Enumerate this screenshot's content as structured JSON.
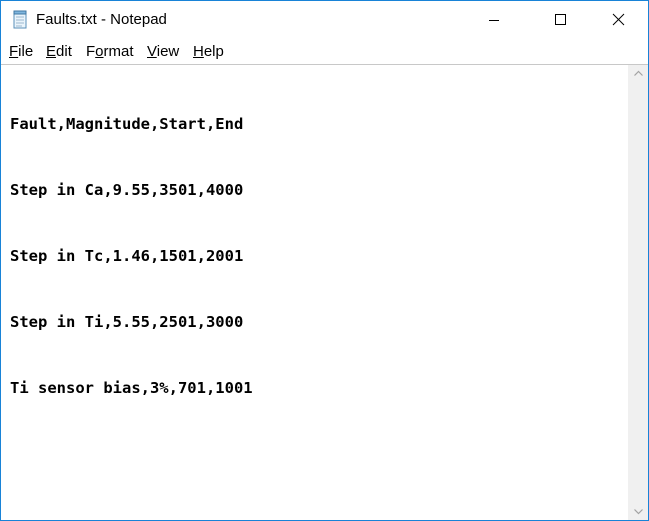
{
  "window": {
    "title": "Faults.txt - Notepad"
  },
  "title_icons": {
    "app": "notepad-icon",
    "minimize": "minimize-icon",
    "maximize": "maximize-icon",
    "close": "close-icon"
  },
  "menu": {
    "file": {
      "mnemonic": "F",
      "rest": "ile"
    },
    "edit": {
      "mnemonic": "E",
      "rest": "dit"
    },
    "format": {
      "mnemonic": "o",
      "pre": "F",
      "rest": "rmat"
    },
    "view": {
      "mnemonic": "V",
      "rest": "iew"
    },
    "help": {
      "mnemonic": "H",
      "rest": "elp"
    }
  },
  "document": {
    "lines": [
      "Fault,Magnitude,Start,End",
      "Step in Ca,9.55,3501,4000",
      "Step in Tc,1.46,1501,2001",
      "Step in Ti,5.55,2501,3000",
      "Ti sensor bias,3%,701,1001"
    ]
  },
  "scrollbar": {
    "up_icon": "scroll-up-arrow-icon",
    "down_icon": "scroll-down-arrow-icon"
  },
  "colors": {
    "window_border": "#1883d7",
    "arrow_gray": "#a3a3a3",
    "scrollbar_track": "#f0f0f0"
  }
}
